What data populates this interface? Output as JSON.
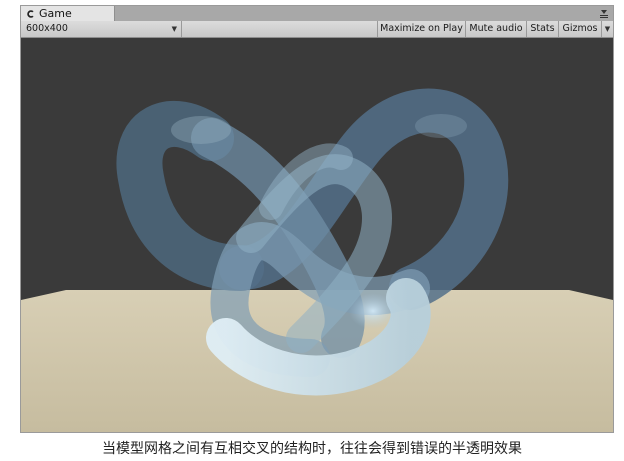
{
  "window": {
    "tab_title": "Game",
    "tab_icon": "unity-game-icon",
    "menu_icon": "window-menu-icon"
  },
  "toolbar": {
    "resolution": "600x400",
    "maximize_on_play": "Maximize on Play",
    "mute_audio": "Mute audio",
    "stats": "Stats",
    "gizmos": "Gizmos"
  },
  "viewport": {
    "sky_color": "#3a3a3a",
    "floor_color": "#cfc5a9",
    "model_color": "#6f8ea5"
  },
  "caption": {
    "text": "当模型网格之间有互相交叉的结构时，往往会得到错误的半透明效果"
  }
}
